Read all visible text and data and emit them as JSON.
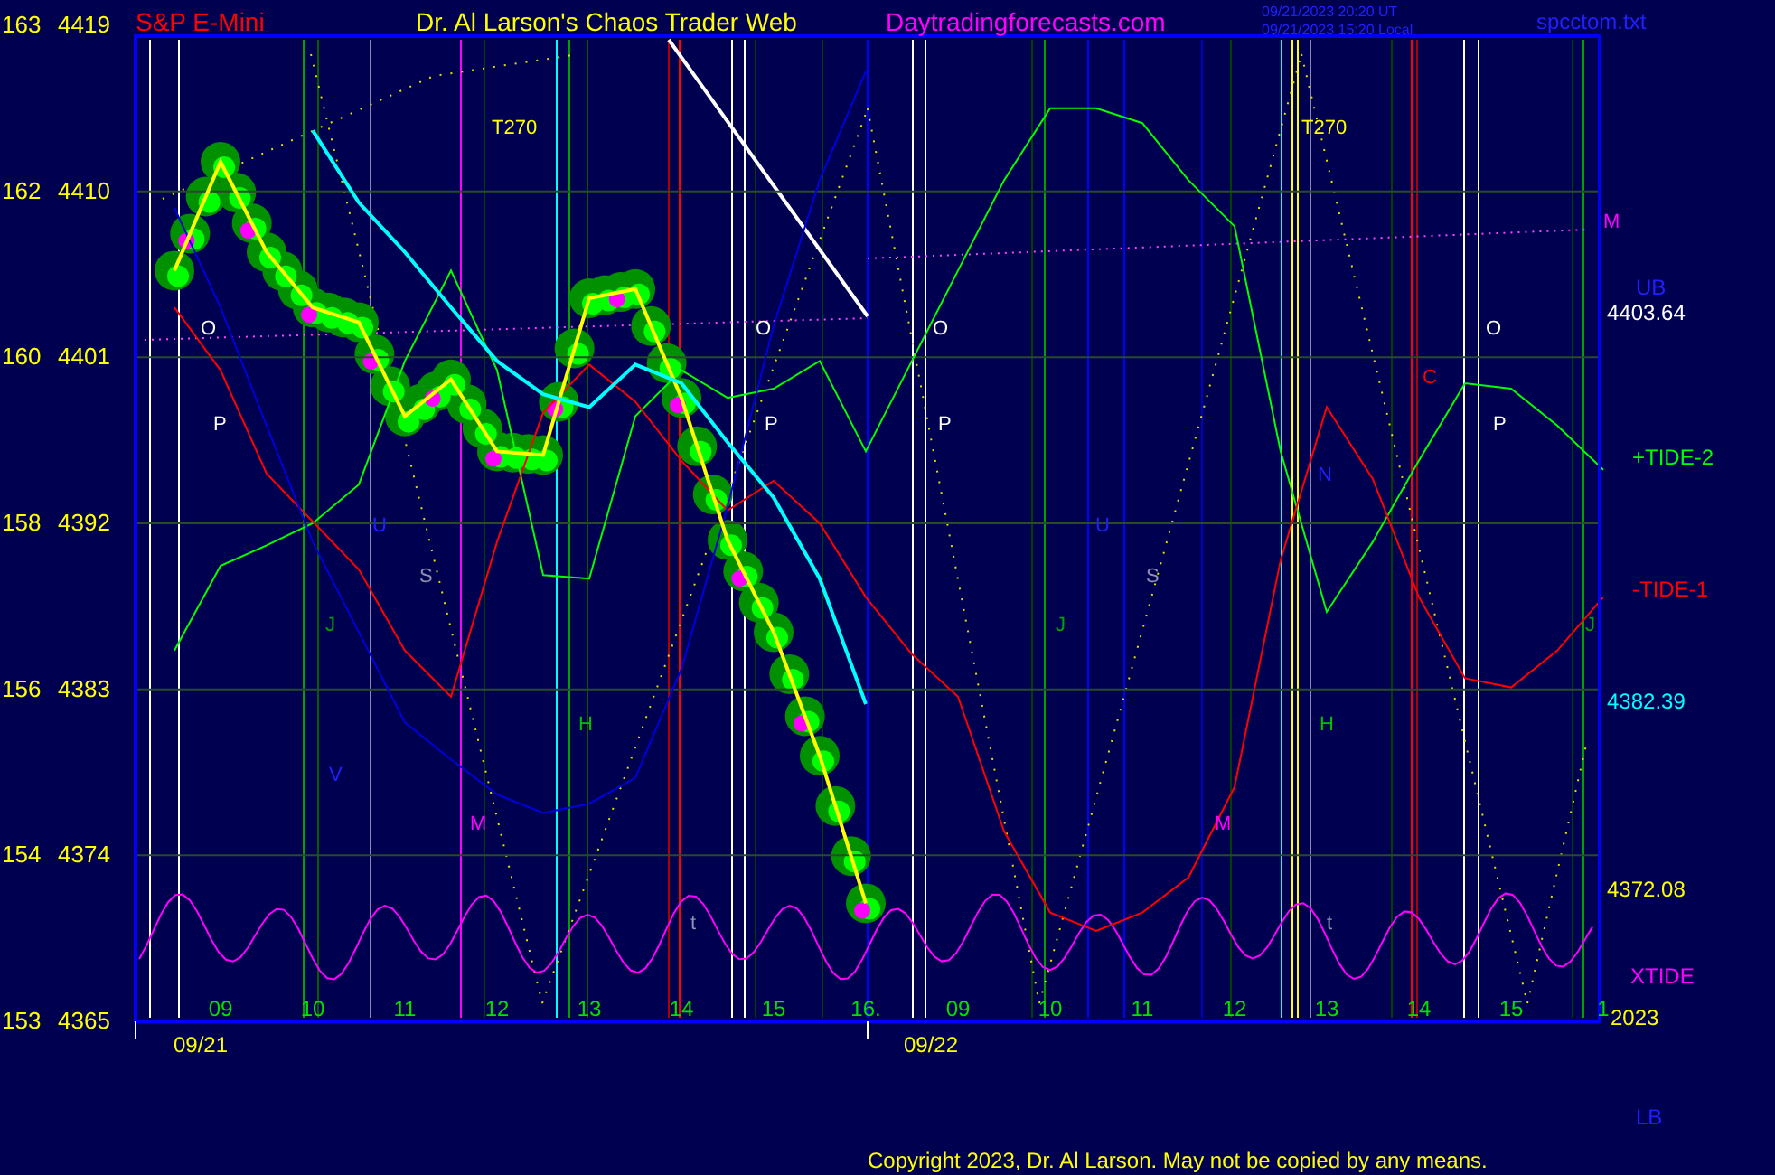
{
  "header": {
    "symbol": "S&P E-Mini",
    "title": "Dr. Al Larson's Chaos Trader Web",
    "site": "Daytradingforecasts.com",
    "timestamps": [
      "09/21/2023 20:20 UT",
      "09/21/2023 15:20 Local"
    ],
    "file": "spcctom.txt"
  },
  "left_scale": [
    "163",
    "162",
    "160",
    "158",
    "156",
    "154",
    "153"
  ],
  "chart_data": {
    "type": "line",
    "grid": true,
    "ylim": [
      4365,
      4419
    ],
    "yticks": [
      4419,
      4410,
      4401,
      4392,
      4383,
      4374,
      4365
    ],
    "categories": [
      null,
      null,
      "09",
      null,
      "10",
      null,
      "11",
      null,
      "12",
      null,
      "13",
      null,
      "14",
      null,
      "15",
      null,
      "16.",
      null,
      "09",
      null,
      "10",
      null,
      "11",
      null,
      "12",
      null,
      "13",
      null,
      "14",
      null,
      "15",
      null,
      "1"
    ],
    "series": [
      {
        "name": "+TIDE-2",
        "color": "#00ff00",
        "values": [
          null,
          4385.1,
          4389.7,
          4390.8,
          4392.0,
          4394.1,
          4400.8,
          4405.7,
          4400.3,
          4389.2,
          4389.0,
          4397.8,
          4400.3,
          4398.8,
          4399.3,
          4400.8,
          4395.9,
          4400.8,
          4405.7,
          4410.6,
          4414.5,
          4414.5,
          4413.7,
          4410.6,
          4408.1,
          4395.9,
          4387.2,
          4391.0,
          4395.4,
          4399.6,
          4399.3,
          4397.3,
          4394.9
        ]
      },
      {
        "name": "-TIDE-1",
        "color": "#ff0000",
        "values": [
          null,
          4403.7,
          4400.3,
          4394.7,
          4392.1,
          4389.5,
          4385.1,
          4382.6,
          4391.0,
          4398.0,
          4400.6,
          4398.6,
          4395.4,
          4392.7,
          4394.3,
          4392.0,
          4388.0,
          4384.9,
          4382.6,
          4375.3,
          4370.9,
          4369.9,
          4370.9,
          4372.8,
          4377.7,
          4390.0,
          4398.3,
          4394.4,
          4388.0,
          4383.6,
          4383.1,
          4385.1,
          4388.0
        ]
      },
      {
        "color": "#0000dd",
        "values": [
          null,
          4409.1,
          4403.7,
          4397.3,
          4391.0,
          4386.1,
          4381.2,
          4379.2,
          4377.3,
          4376.3,
          4376.8,
          4378.2,
          4384.1,
          4392.9,
          4402.7,
          4410.6,
          4416.5,
          null,
          null,
          null,
          null,
          null,
          null,
          null,
          null,
          null,
          null,
          null,
          null,
          null,
          null,
          null,
          null
        ]
      },
      {
        "color": "#ffff00",
        "values": [
          null,
          4405.7,
          4411.6,
          4406.7,
          4403.7,
          4402.9,
          4397.8,
          4399.8,
          4395.9,
          4395.7,
          4404.2,
          4404.7,
          4398.8,
          4391.1,
          4386.1,
          4379.4,
          4371.4,
          null,
          null,
          null,
          null,
          null,
          null,
          null,
          null,
          null,
          null,
          null,
          null,
          null,
          null,
          null,
          null
        ]
      },
      {
        "color": "#00ffff",
        "values": [
          null,
          null,
          null,
          null,
          4413.3,
          4409.4,
          4406.7,
          4403.7,
          4400.8,
          4399.0,
          4398.3,
          4400.6,
          4399.6,
          4396.4,
          4393.4,
          4389.0,
          4382.2,
          null,
          null,
          null,
          null,
          null,
          null,
          null,
          null,
          null,
          null,
          null,
          null,
          null,
          null,
          null,
          null
        ]
      }
    ]
  },
  "markers": [
    {
      "text": "O",
      "color": "#ffffff"
    },
    {
      "text": "P",
      "color": "#ffffff"
    },
    {
      "text": "U",
      "color": "#2020ff"
    },
    {
      "text": "S",
      "color": "#9090b0"
    },
    {
      "text": "J",
      "color": "#00a000"
    },
    {
      "text": "V",
      "color": "#2020ff"
    },
    {
      "text": "M",
      "color": "#ff00ff"
    },
    {
      "text": "T270",
      "color": "#ffff00"
    },
    {
      "text": "H",
      "color": "#00c000"
    },
    {
      "text": "t",
      "color": "#9090b0"
    },
    {
      "text": "O",
      "color": "#ffffff"
    },
    {
      "text": "P",
      "color": "#ffffff"
    },
    {
      "text": "O",
      "color": "#ffffff"
    },
    {
      "text": "P",
      "color": "#ffffff"
    },
    {
      "text": "U",
      "color": "#2020ff"
    },
    {
      "text": "S",
      "color": "#9090b0"
    },
    {
      "text": "J",
      "color": "#00a000"
    },
    {
      "text": "M",
      "color": "#ff00ff"
    },
    {
      "text": "T270",
      "color": "#ffff00"
    },
    {
      "text": "N",
      "color": "#2020ff"
    },
    {
      "text": "H",
      "color": "#00c000"
    },
    {
      "text": "t",
      "color": "#9090b0"
    },
    {
      "text": "C",
      "color": "#ff0000"
    },
    {
      "text": "O",
      "color": "#ffffff"
    },
    {
      "text": "P",
      "color": "#ffffff"
    },
    {
      "text": "J",
      "color": "#00a000"
    },
    {
      "text": "M",
      "color": "#ff00ff"
    }
  ],
  "right_labels": [
    {
      "text": "UB",
      "color": "#2020ff"
    },
    {
      "text": "4403.64",
      "color": "#ffffff"
    },
    {
      "text": "4382.39",
      "color": "#00ffff"
    },
    {
      "text": "4372.08",
      "color": "#ffff00"
    },
    {
      "text": "XTIDE",
      "color": "#ff00ff"
    },
    {
      "text": "2023",
      "color": "#ffff00"
    },
    {
      "text": "LB",
      "color": "#2020ff"
    }
  ],
  "x_dates": [
    "09/21",
    "09/22"
  ],
  "copyright": "Copyright 2023, Dr. Al Larson. May not be copied by any means."
}
